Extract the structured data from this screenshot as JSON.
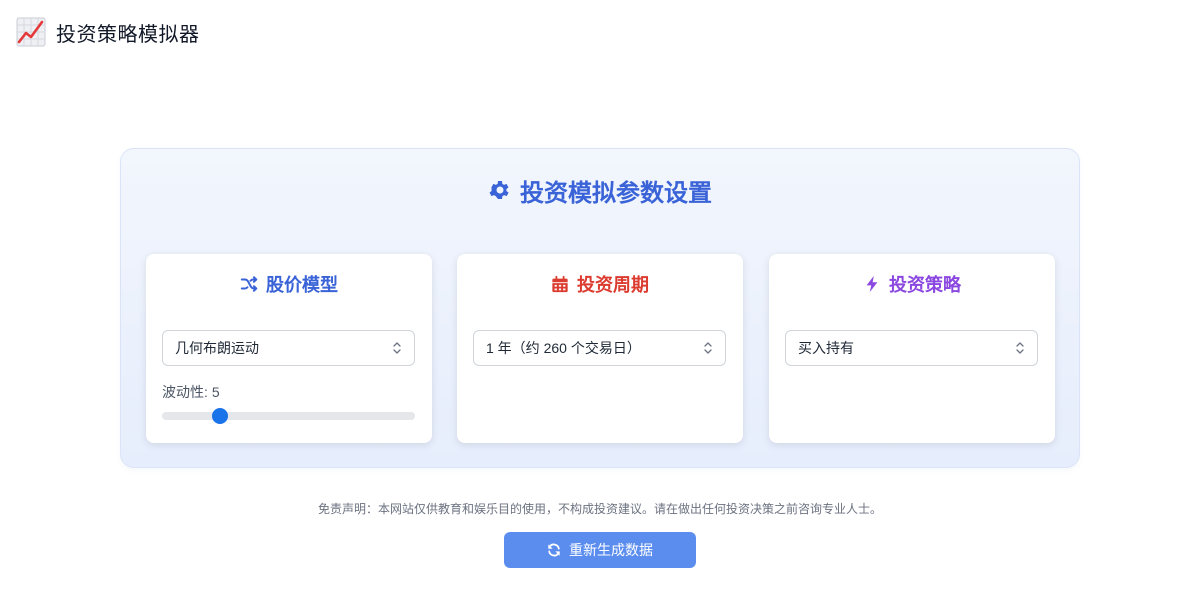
{
  "app": {
    "title": "投资策略模拟器",
    "icon": "chart-increasing-icon"
  },
  "panel": {
    "title": "投资模拟参数设置",
    "icon": "gear-icon",
    "accent": "#3a63d8"
  },
  "cards": [
    {
      "title": "股价模型",
      "icon": "shuffle-icon",
      "color": "#3a63d8",
      "select": {
        "value": "几何布朗运动"
      },
      "volatility": {
        "label": "波动性:",
        "value": "5",
        "level": 0.23
      }
    },
    {
      "title": "投资周期",
      "icon": "calendar-icon",
      "color": "#dc3b2f",
      "select": {
        "value": "1 年（约 260 个交易日）"
      }
    },
    {
      "title": "投资策略",
      "icon": "bolt-icon",
      "color": "#8b48e0",
      "select": {
        "value": "买入持有"
      }
    }
  ],
  "disclaimer": "免责声明：本网站仅供教育和娱乐目的使用，不构成投资建议。请在做出任何投资决策之前咨询专业人士。",
  "regenerate": {
    "label": "重新生成数据",
    "icon": "refresh-icon",
    "color": "#5b8def"
  }
}
